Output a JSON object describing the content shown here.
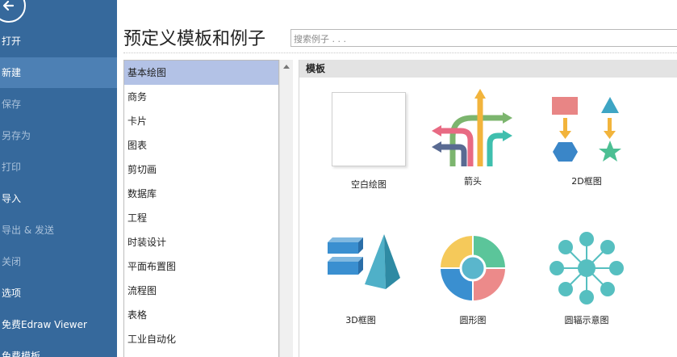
{
  "sidebar": {
    "items": [
      {
        "label": "打开",
        "state": "normal"
      },
      {
        "label": "新建",
        "state": "active"
      },
      {
        "label": "保存",
        "state": "dim"
      },
      {
        "label": "另存为",
        "state": "dim"
      },
      {
        "label": "打印",
        "state": "dim"
      },
      {
        "label": "导入",
        "state": "normal"
      },
      {
        "label": "导出 & 发送",
        "state": "dim"
      },
      {
        "label": "关闭",
        "state": "dim"
      },
      {
        "label": "选项",
        "state": "normal"
      },
      {
        "label": "免费Edraw Viewer",
        "state": "normal"
      },
      {
        "label": "免费模板",
        "state": "normal"
      }
    ]
  },
  "header": {
    "title": "预定义模板和例子",
    "search_placeholder": "搜索例子 . . ."
  },
  "categories": [
    "基本绘图",
    "商务",
    "卡片",
    "图表",
    "剪切画",
    "数据库",
    "工程",
    "时装设计",
    "平面布置图",
    "流程图",
    "表格",
    "工业自动化"
  ],
  "templates": {
    "section_title": "模板",
    "items": [
      {
        "label": "空白绘图",
        "icon": "blank-page-icon"
      },
      {
        "label": "箭头",
        "icon": "arrows-icon"
      },
      {
        "label": "2D框图",
        "icon": "2d-block-icon"
      },
      {
        "label": "3D框图",
        "icon": "3d-block-icon"
      },
      {
        "label": "圆形图",
        "icon": "circular-chart-icon"
      },
      {
        "label": "圆辐示意图",
        "icon": "radial-diagram-icon"
      }
    ]
  },
  "colors": {
    "sidebar_bg": "#36699c",
    "sidebar_active": "#4d80b4",
    "category_selected": "#b3c2e6",
    "section_header": "#e3e3e3"
  }
}
